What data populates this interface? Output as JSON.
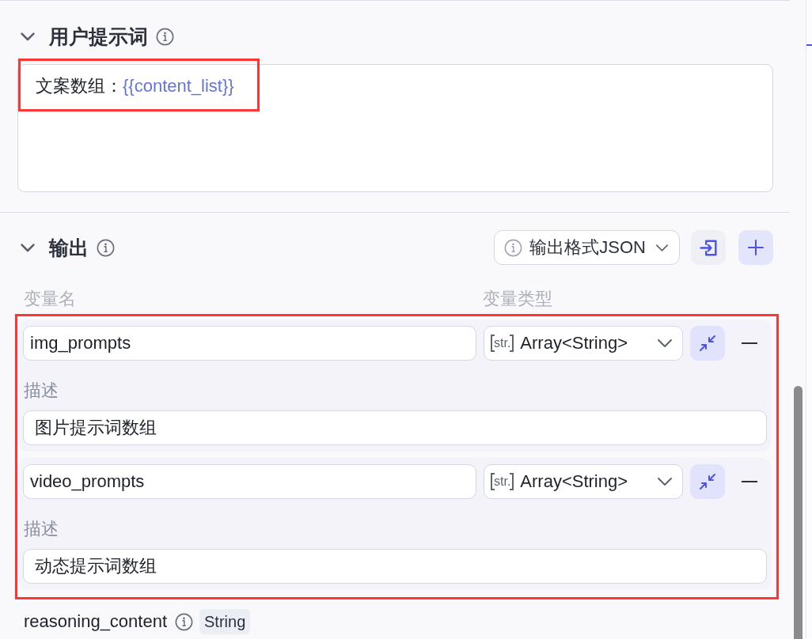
{
  "user_prompt": {
    "title": "用户提示词",
    "expanded": true,
    "highlight": true,
    "content": [
      {
        "kind": "text",
        "text": "文案数组："
      },
      {
        "kind": "variable",
        "text": "{{content_list}}"
      }
    ]
  },
  "output": {
    "title": "输出",
    "expanded": true,
    "format_select": "输出格式JSON",
    "columns": [
      "变量名",
      "变量类型"
    ],
    "highlight": true,
    "variables": [
      {
        "name": "img_prompts",
        "type_icon": "str.",
        "type": "Array<String>",
        "expanded": true,
        "description_label": "描述",
        "description": "图片提示词数组"
      },
      {
        "name": "video_prompts",
        "type_icon": "str.",
        "type": "Array<String>",
        "expanded": true,
        "description_label": "描述",
        "description": "动态提示词数组"
      }
    ],
    "extra_outputs": [
      {
        "name": "reasoning_content",
        "type": "String"
      }
    ]
  }
}
